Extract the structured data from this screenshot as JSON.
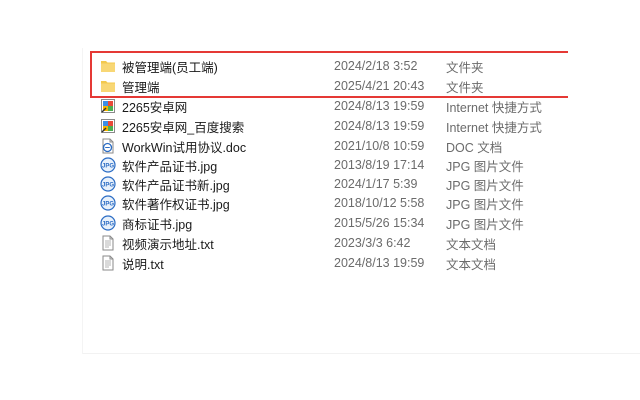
{
  "colors": {
    "highlight_border": "#e53935",
    "folder": "#f3c94e",
    "jpg_badge": "#2b6cc4",
    "secondary_text": "#6b6b6b"
  },
  "files": [
    {
      "name": "被管理端(员工端)",
      "date": "2024/2/18 3:52",
      "type": "文件夹",
      "icon": "folder-icon"
    },
    {
      "name": "管理端",
      "date": "2025/4/21 20:43",
      "type": "文件夹",
      "icon": "folder-icon"
    },
    {
      "name": "2265安卓网",
      "date": "2024/8/13 19:59",
      "type": "Internet 快捷方式",
      "icon": "internet-shortcut-icon"
    },
    {
      "name": "2265安卓网_百度搜索",
      "date": "2024/8/13 19:59",
      "type": "Internet 快捷方式",
      "icon": "internet-shortcut-icon"
    },
    {
      "name": "WorkWin试用协议.doc",
      "date": "2021/10/8 10:59",
      "type": "DOC 文档",
      "icon": "doc-file-icon"
    },
    {
      "name": "软件产品证书.jpg",
      "date": "2013/8/19 17:14",
      "type": "JPG 图片文件",
      "icon": "jpg-file-icon"
    },
    {
      "name": "软件产品证书新.jpg",
      "date": "2024/1/17 5:39",
      "type": "JPG 图片文件",
      "icon": "jpg-file-icon"
    },
    {
      "name": "软件著作权证书.jpg",
      "date": "2018/10/12 5:58",
      "type": "JPG 图片文件",
      "icon": "jpg-file-icon"
    },
    {
      "name": "商标证书.jpg",
      "date": "2015/5/26 15:34",
      "type": "JPG 图片文件",
      "icon": "jpg-file-icon"
    },
    {
      "name": "视频演示地址.txt",
      "date": "2023/3/3 6:42",
      "type": "文本文档",
      "icon": "txt-file-icon"
    },
    {
      "name": "说明.txt",
      "date": "2024/8/13 19:59",
      "type": "文本文档",
      "icon": "txt-file-icon"
    }
  ]
}
